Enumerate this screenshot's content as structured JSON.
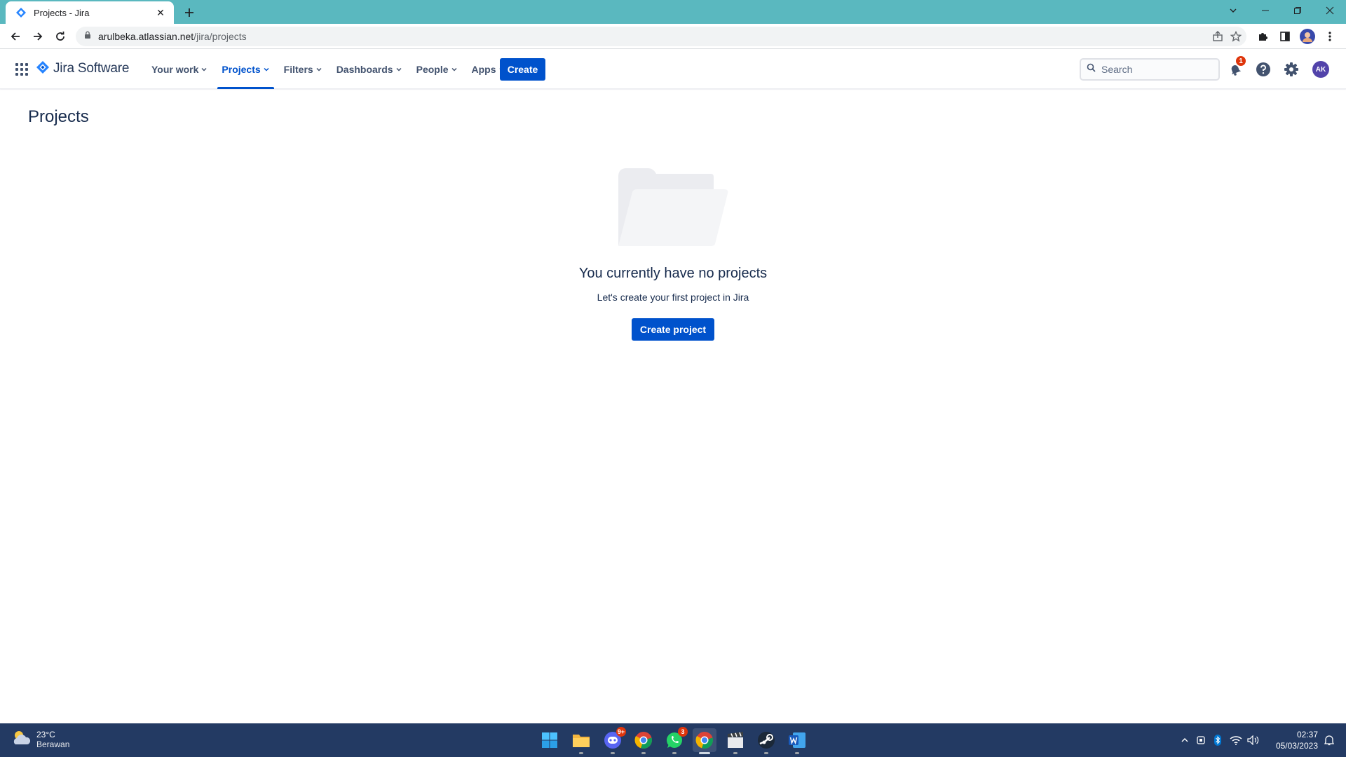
{
  "browser": {
    "tab_title": "Projects - Jira",
    "url_host": "arulbeka.atlassian.net",
    "url_path": "/jira/projects"
  },
  "jira_nav": {
    "product_name": "Jira Software",
    "items": [
      {
        "label": "Your work",
        "active": false
      },
      {
        "label": "Projects",
        "active": true
      },
      {
        "label": "Filters",
        "active": false
      },
      {
        "label": "Dashboards",
        "active": false
      },
      {
        "label": "People",
        "active": false
      },
      {
        "label": "Apps",
        "active": false
      }
    ],
    "create_label": "Create",
    "search_placeholder": "Search",
    "notification_count": "1",
    "avatar_initials": "AK",
    "accent_color": "#0052cc"
  },
  "page": {
    "title": "Projects",
    "empty_state": {
      "heading": "You currently have no projects",
      "subheading": "Let's create your first project in Jira",
      "cta_label": "Create project"
    }
  },
  "taskbar": {
    "weather_temp": "23°C",
    "weather_condition": "Berawan",
    "apps": [
      {
        "name": "windows-start-icon"
      },
      {
        "name": "file-explorer-icon"
      },
      {
        "name": "discord-icon",
        "badge": "9+"
      },
      {
        "name": "chrome-icon",
        "badge": ""
      },
      {
        "name": "whatsapp-icon",
        "badge": "3"
      },
      {
        "name": "chrome-profile-icon",
        "badge": ""
      },
      {
        "name": "clapper-icon"
      },
      {
        "name": "steam-icon"
      },
      {
        "name": "word-icon"
      }
    ],
    "time": "02:37",
    "date": "05/03/2023"
  }
}
